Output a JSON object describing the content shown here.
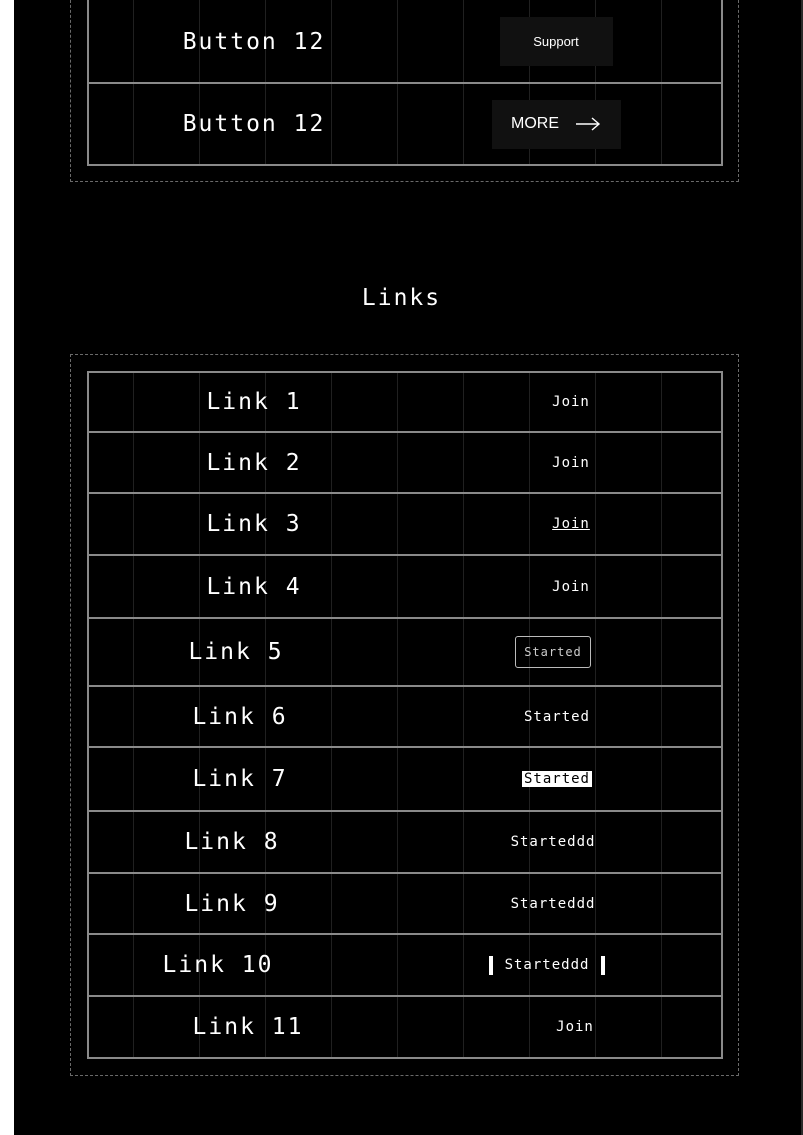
{
  "buttons_section": {
    "rows": [
      {
        "label": "Button 12",
        "action": "Support"
      },
      {
        "label": "Button 12",
        "action": "MORE",
        "action_icon": "arrow-right-icon"
      }
    ]
  },
  "links_section": {
    "title": "Links",
    "rows": [
      {
        "label": "Link 1",
        "action": "Join"
      },
      {
        "label": "Link 2",
        "action": "Join"
      },
      {
        "label": "Link 3",
        "action": "Join"
      },
      {
        "label": "Link 4",
        "action": "Join"
      },
      {
        "label": "Link 5",
        "action": "Started"
      },
      {
        "label": "Link 6",
        "action": "Started"
      },
      {
        "label": "Link 7",
        "action": "Started"
      },
      {
        "label": "Link 8",
        "action": "Starteddd"
      },
      {
        "label": "Link 9",
        "action": "Starteddd"
      },
      {
        "label": "Link 10",
        "action": "Starteddd"
      },
      {
        "label": "Link 11",
        "action": "Join"
      }
    ]
  }
}
